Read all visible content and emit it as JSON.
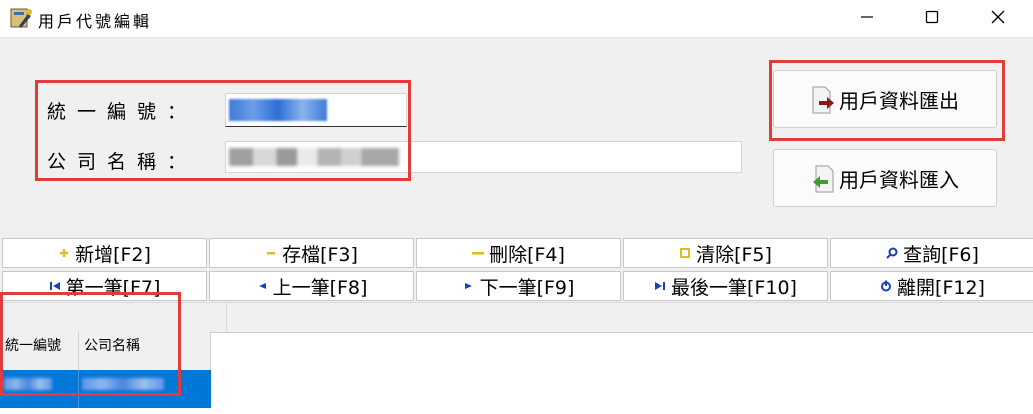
{
  "window": {
    "title": "用戶代號編輯",
    "icon": "app-icon",
    "controls": [
      "minimize-icon",
      "maximize-icon",
      "close-icon"
    ]
  },
  "form": {
    "tax_id_label": "統一編號：",
    "company_name_label": "公司名稱：",
    "tax_id_value": "",
    "company_name_value": ""
  },
  "actions": {
    "export_label": "用戶資料匯出",
    "import_label": "用戶資料匯入"
  },
  "toolbar": {
    "row1": [
      {
        "label": "新增[F2]",
        "icon": "add-icon"
      },
      {
        "label": "存檔[F3]",
        "icon": "save-icon"
      },
      {
        "label": "刪除[F4]",
        "icon": "delete-icon"
      },
      {
        "label": "清除[F5]",
        "icon": "clear-icon"
      },
      {
        "label": "查詢[F6]",
        "icon": "search-icon"
      }
    ],
    "row2": [
      {
        "label": "第一筆[F7]",
        "icon": "first-record-icon"
      },
      {
        "label": "上一筆[F8]",
        "icon": "previous-record-icon"
      },
      {
        "label": "下一筆[F9]",
        "icon": "next-record-icon"
      },
      {
        "label": "最後一筆[F10]",
        "icon": "last-record-icon"
      },
      {
        "label": "離開[F12]",
        "icon": "exit-icon"
      }
    ]
  },
  "grid": {
    "columns": [
      "統一編號",
      "公司名稱"
    ],
    "selected_row_color": "#0078d7"
  },
  "colors": {
    "highlight_box": "#e03c3c",
    "icon_blue": "#1a3fbf",
    "icon_yellow": "#d8c21a"
  }
}
